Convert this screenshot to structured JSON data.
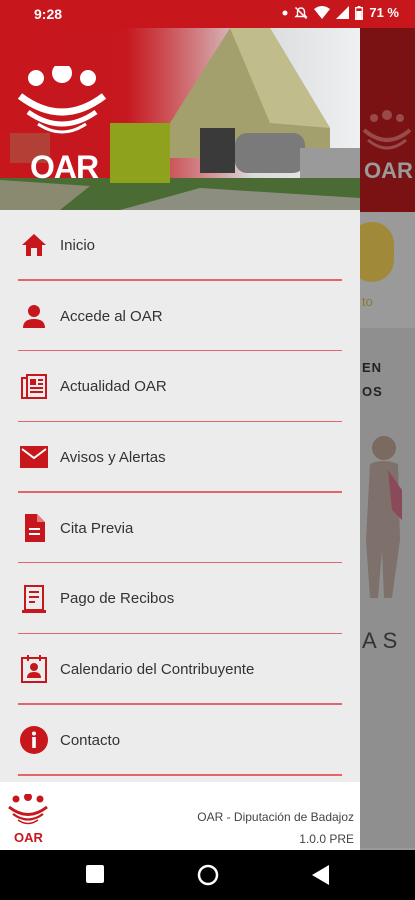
{
  "status_bar": {
    "time": "9:28",
    "battery_percent": "71 %",
    "icons": [
      "notification-dot-icon",
      "mute-icon",
      "wifi-icon",
      "signal-icon",
      "battery-icon"
    ]
  },
  "drawer": {
    "header": {
      "logo_text": "OAR"
    },
    "items": [
      {
        "label": "Inicio",
        "icon": "home-icon"
      },
      {
        "label": "Accede al OAR",
        "icon": "person-icon"
      },
      {
        "label": "Actualidad OAR",
        "icon": "news-icon"
      },
      {
        "label": "Avisos y Alertas",
        "icon": "mail-icon"
      },
      {
        "label": "Cita Previa",
        "icon": "document-icon"
      },
      {
        "label": "Pago de Recibos",
        "icon": "receipt-icon"
      },
      {
        "label": "Calendario del Contribuyente",
        "icon": "calendar-contact-icon"
      },
      {
        "label": "Contacto",
        "icon": "info-icon"
      }
    ],
    "footer": {
      "logo_text": "OAR",
      "organization": "OAR - Diputación de Badajoz",
      "version": "1.0.0 PRE"
    }
  },
  "background_app": {
    "circle_label": "to",
    "text_lines": [
      "EN",
      "OS"
    ],
    "bottom_text": "AS"
  },
  "colors": {
    "brand_red": "#c8161d",
    "divider": "#e2656b",
    "drawer_bg": "#ececec"
  }
}
